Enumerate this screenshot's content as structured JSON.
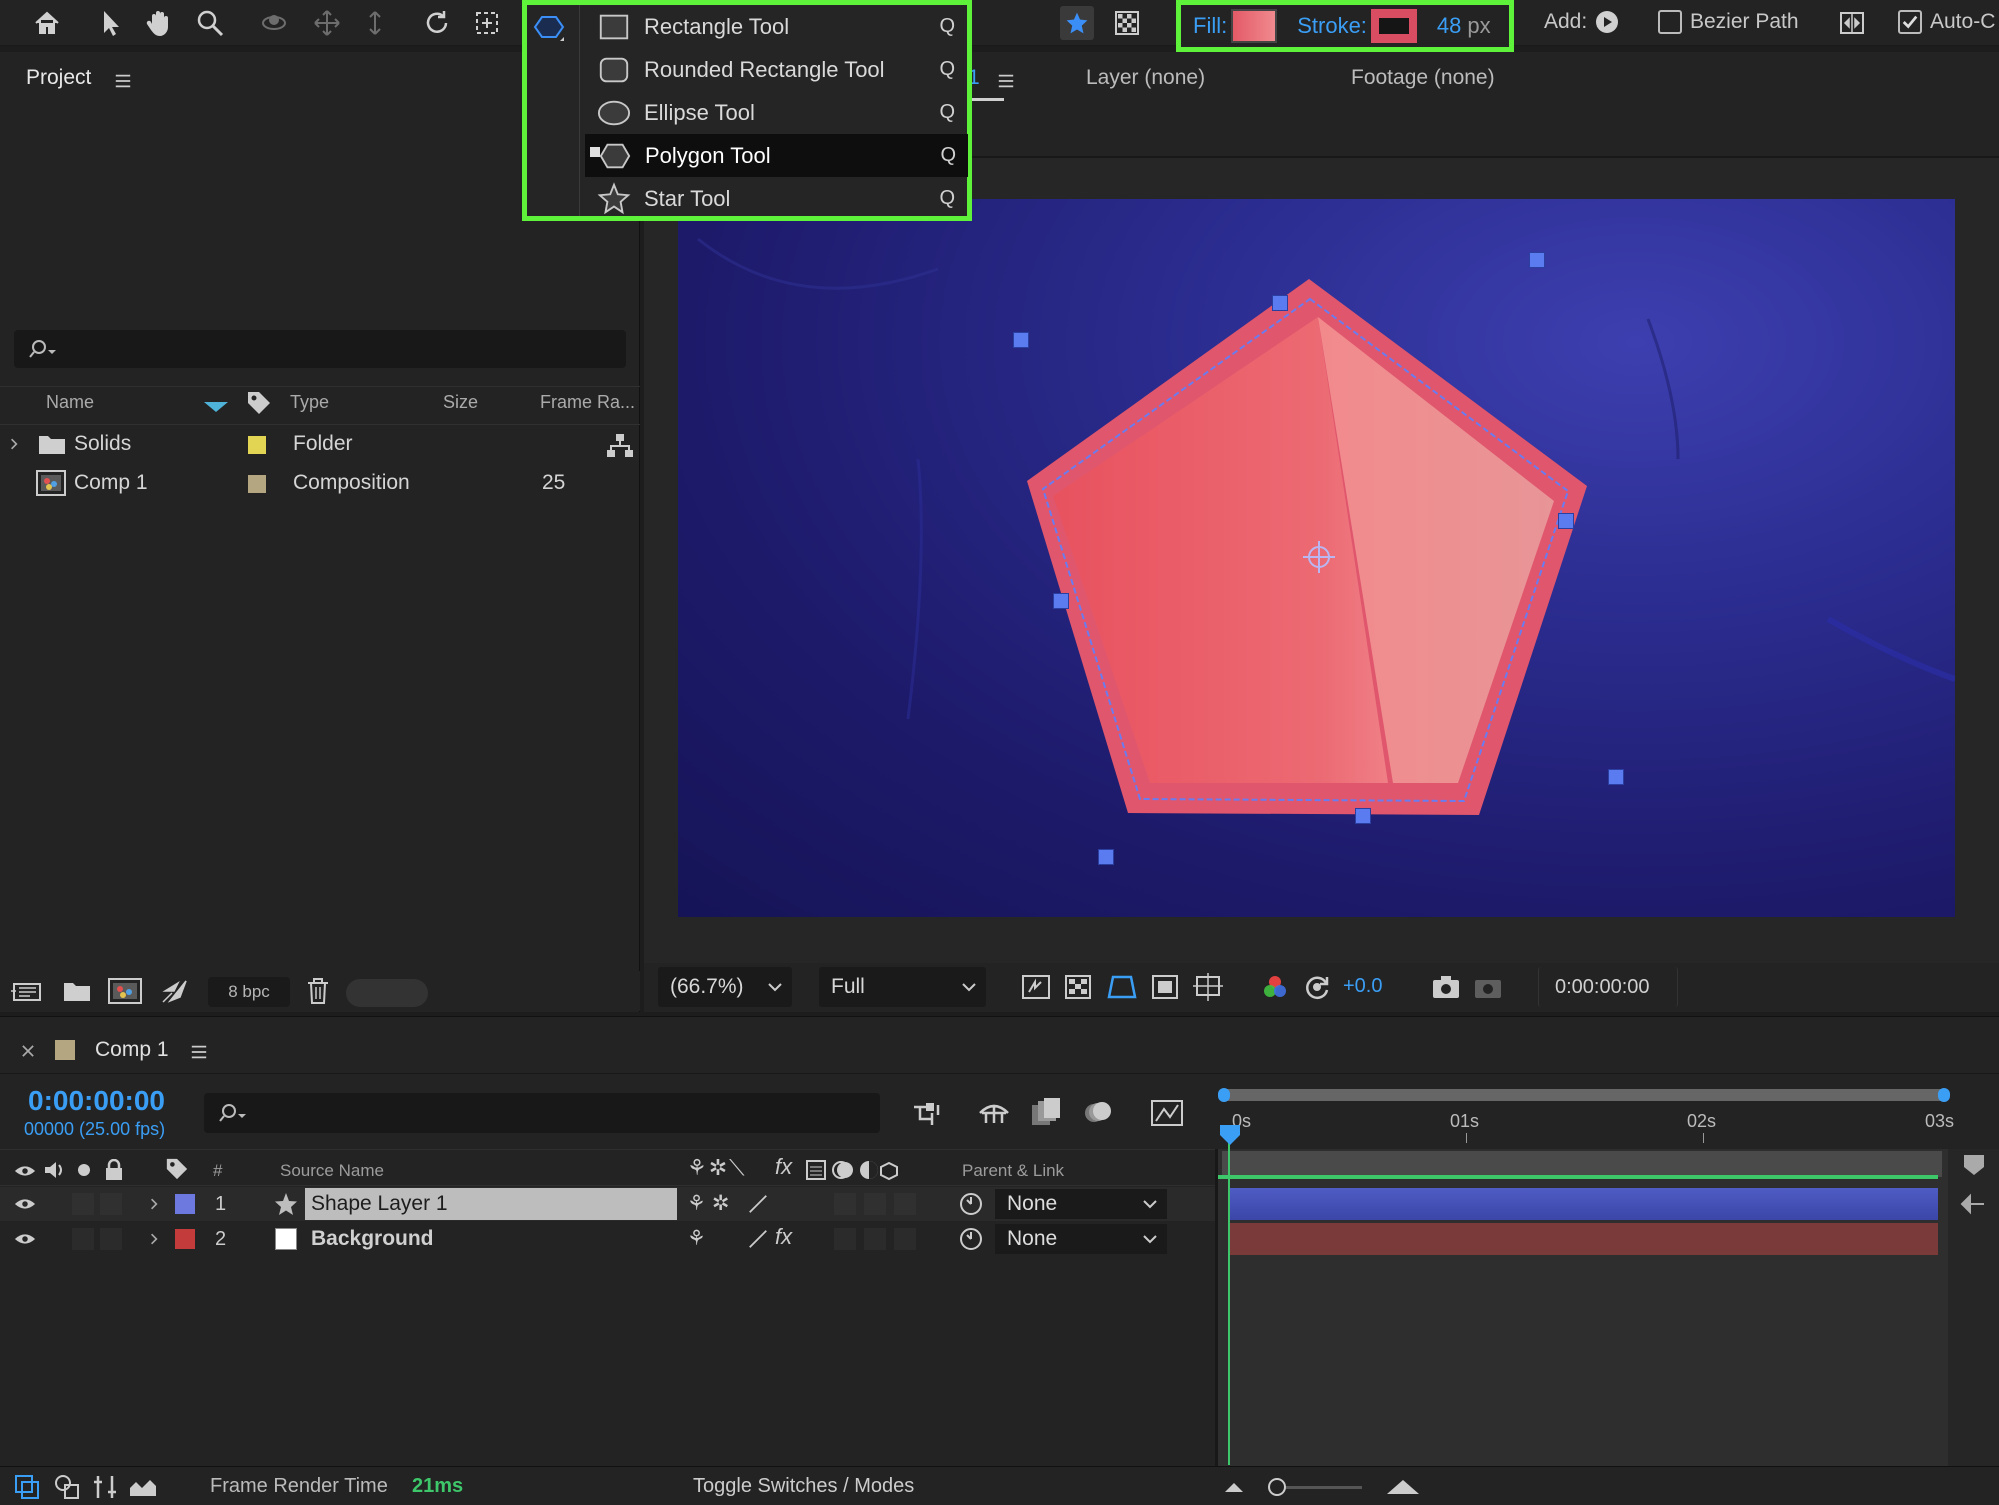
{
  "toolbar": {
    "tools": [
      "home-icon",
      "selection-icon",
      "hand-icon",
      "zoom-icon",
      "orbit-icon",
      "pan-icon",
      "dolly-icon",
      "rotate-icon",
      "pan-behind-icon",
      "polygon-icon"
    ],
    "fill_label": "Fill:",
    "stroke_label": "Stroke:",
    "stroke_width": "48",
    "stroke_unit": "px",
    "add_label": "Add:",
    "bezier_label": "Bezier Path",
    "auto_label": "Auto-C"
  },
  "shape_menu": {
    "items": [
      {
        "label": "Rectangle Tool",
        "key": "Q",
        "icon": "rectangle-icon"
      },
      {
        "label": "Rounded Rectangle Tool",
        "key": "Q",
        "icon": "rounded-rectangle-icon"
      },
      {
        "label": "Ellipse Tool",
        "key": "Q",
        "icon": "ellipse-icon"
      },
      {
        "label": "Polygon Tool",
        "key": "Q",
        "icon": "polygon-icon",
        "active": true
      },
      {
        "label": "Star Tool",
        "key": "Q",
        "icon": "star-icon"
      }
    ]
  },
  "project": {
    "title": "Project",
    "columns": {
      "name": "Name",
      "type": "Type",
      "size": "Size",
      "frame_rate": "Frame Ra..."
    },
    "items": [
      {
        "name": "Solids",
        "type": "Folder",
        "color": "#e2d553",
        "frame_rate": ""
      },
      {
        "name": "Comp 1",
        "type": "Composition",
        "color": "#b3a681",
        "frame_rate": "25"
      }
    ],
    "bpc": "8 bpc"
  },
  "viewer": {
    "tab_partial": "1",
    "layer_tab": "Layer (none)",
    "footage_tab": "Footage (none)",
    "zoom": "(66.7%)",
    "resolution": "Full",
    "exposure": "+0.0",
    "timecode": "0:00:00:00"
  },
  "timeline": {
    "comp_name": "Comp 1",
    "timecode": "0:00:00:00",
    "frames": "00000 (25.00 fps)",
    "col_num": "#",
    "col_source": "Source Name",
    "col_parent": "Parent & Link",
    "ruler": [
      "0s",
      "01s",
      "02s",
      "03s"
    ],
    "layers": [
      {
        "num": "1",
        "name": "Shape Layer 1",
        "color": "#6e79e0",
        "parent": "None"
      },
      {
        "num": "2",
        "name": "Background",
        "color": "#c43b3b",
        "parent": "None"
      }
    ]
  },
  "status": {
    "render_label": "Frame Render Time",
    "render_time": "21ms",
    "toggle_label": "Toggle Switches / Modes"
  },
  "colors": {
    "accent_blue": "#3b9ef5",
    "highlight_green": "#5ff23a",
    "fill_swatch": "#e86872",
    "stroke_swatch": "#d84d62"
  }
}
